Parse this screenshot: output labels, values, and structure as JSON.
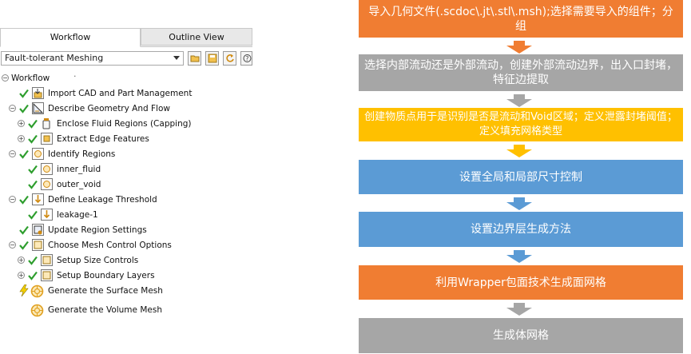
{
  "tabs": {
    "workflow": "Workflow",
    "outline": "Outline View"
  },
  "toolbar": {
    "workflow_type": "Fault-tolerant Meshing"
  },
  "tree": {
    "root": "Workflow",
    "items": [
      {
        "label": "Import CAD and Part Management"
      },
      {
        "label": "Describe Geometry And Flow"
      },
      {
        "label": "Enclose Fluid Regions (Capping)"
      },
      {
        "label": "Extract Edge Features"
      },
      {
        "label": "Identify Regions"
      },
      {
        "label": "inner_fluid"
      },
      {
        "label": "outer_void"
      },
      {
        "label": "Define Leakage Threshold"
      },
      {
        "label": "leakage-1"
      },
      {
        "label": "Update Region Settings"
      },
      {
        "label": "Choose Mesh Control Options"
      },
      {
        "label": "Setup Size Controls"
      },
      {
        "label": "Setup Boundary Layers"
      },
      {
        "label": "Generate the Surface Mesh"
      },
      {
        "label": "Generate the Volume Mesh"
      }
    ]
  },
  "flow": {
    "steps": [
      {
        "text": "导入几何文件(.scdoc\\.jt\\.stl\\.msh);选择需要导入的组件；分组",
        "color": "#f07d32",
        "arrow_color": "#f07d32"
      },
      {
        "text": "选择内部流动还是外部流动，创建外部流动边界，出入口封堵，特征边提取",
        "color": "#a6a6a6",
        "arrow_color": "#a6a6a6"
      },
      {
        "text": "创建物质点用于是识别是否是流动和Void区域；定义泄露封堵阈值；定义填充网格类型",
        "color": "#ffc000",
        "arrow_color": "#ffc000"
      },
      {
        "text": "设置全局和局部尺寸控制",
        "color": "#5b9bd5",
        "arrow_color": "#5b9bd5"
      },
      {
        "text": "设置边界层生成方法",
        "color": "#5b9bd5",
        "arrow_color": "#5b9bd5"
      },
      {
        "text": "利用Wrapper包面技术生成面网格",
        "color": "#f07d32",
        "arrow_color": "#a6a6a6"
      },
      {
        "text": "生成体网格",
        "color": "#a6a6a6"
      }
    ]
  },
  "colors": {
    "check_green": "#2e9e2e",
    "mesh_gear": "#e0a020"
  }
}
